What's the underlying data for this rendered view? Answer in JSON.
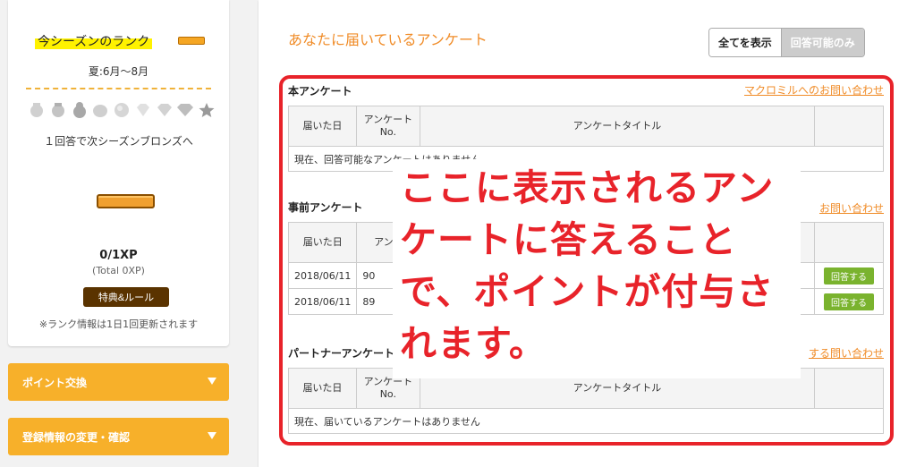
{
  "rank": {
    "title": "今シーズンのランク",
    "season": "夏:6月～8月",
    "medals": [
      "bronze-icon",
      "silver-icon",
      "gold-icon",
      "platinum-icon",
      "pearl-icon",
      "diamond-icon",
      "diamond-icon",
      "diamond-icon",
      "star-icon"
    ],
    "next_text": "１回答で次シーズンブロンズへ",
    "xp": "0/1XP",
    "xp_total": "(Total 0XP)",
    "rules_button": "特典&ルール",
    "note": "※ランク情報は1日1回更新されます"
  },
  "sidebar": {
    "points_exchange": "ポイント交換",
    "profile_edit": "登録情報の変更・確認"
  },
  "main": {
    "title": "あなたに届いているアンケート",
    "filter_all": "全てを表示",
    "filter_answerable": "回答可能のみ"
  },
  "sections": {
    "main_survey": {
      "title": "本アンケート",
      "link": "マクロミルへのお問い合わせ",
      "col_date": "届いた日",
      "col_no": "アンケート No.",
      "col_title": "アンケートタイトル",
      "empty": "現在、回答可能なアンケートはありません"
    },
    "pre_survey": {
      "title": "事前アンケート",
      "link": "お問い合わせ",
      "col_date": "届いた日",
      "col_no": "アンケ",
      "rows": [
        {
          "date": "2018/06/11",
          "no": "90",
          "button": "回答する"
        },
        {
          "date": "2018/06/11",
          "no": "89",
          "button": "回答する"
        }
      ]
    },
    "partner_survey": {
      "title": "パートナーアンケート",
      "link": "する問い合わせ",
      "col_date": "届いた日",
      "col_no": "アンケート No.",
      "col_title": "アンケートタイトル",
      "empty": "現在、届いているアンケートはありません"
    }
  },
  "overlay": {
    "line1": "ここに表示されるアン",
    "line2": "ケートに答えること",
    "line3": "で、ポイントが付与さ",
    "line4": "れます。"
  },
  "colors": {
    "accent_orange": "#f08c28",
    "sidebar_orange": "#f7b02a",
    "frame_red": "#e8232a",
    "answer_green": "#7ab32e"
  }
}
